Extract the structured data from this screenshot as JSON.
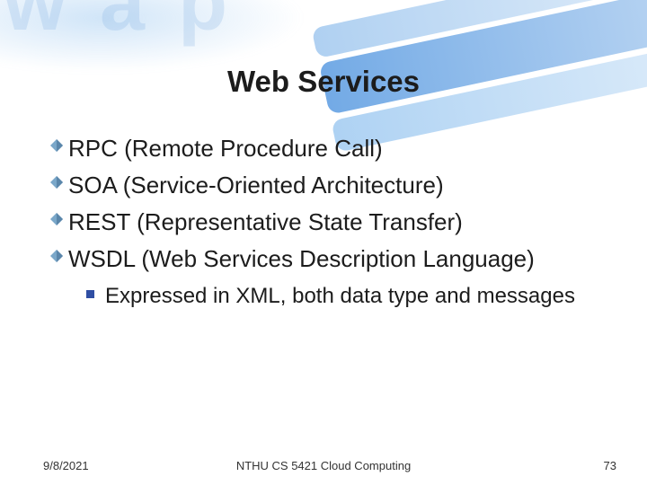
{
  "title": "Web Services",
  "bullets": [
    {
      "text": "RPC (Remote Procedure Call)"
    },
    {
      "text": "SOA (Service-Oriented Architecture)"
    },
    {
      "text": "REST (Representative State Transfer)"
    },
    {
      "text": "WSDL (Web Services Description Language)"
    }
  ],
  "sub_bullets": [
    {
      "text": "Expressed in XML, both data type and messages"
    }
  ],
  "footer": {
    "date": "9/8/2021",
    "course": "NTHU CS 5421 Cloud Computing",
    "page": "73"
  },
  "bg_glyphs": "w a p"
}
